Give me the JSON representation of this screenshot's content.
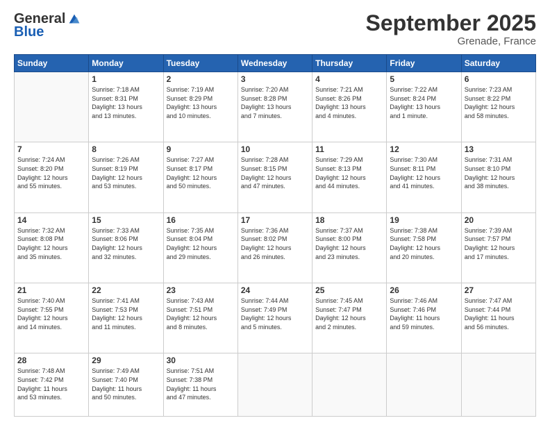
{
  "logo": {
    "general": "General",
    "blue": "Blue"
  },
  "header": {
    "month": "September 2025",
    "location": "Grenade, France"
  },
  "days_of_week": [
    "Sunday",
    "Monday",
    "Tuesday",
    "Wednesday",
    "Thursday",
    "Friday",
    "Saturday"
  ],
  "weeks": [
    [
      {
        "day": "",
        "info": ""
      },
      {
        "day": "1",
        "info": "Sunrise: 7:18 AM\nSunset: 8:31 PM\nDaylight: 13 hours\nand 13 minutes."
      },
      {
        "day": "2",
        "info": "Sunrise: 7:19 AM\nSunset: 8:29 PM\nDaylight: 13 hours\nand 10 minutes."
      },
      {
        "day": "3",
        "info": "Sunrise: 7:20 AM\nSunset: 8:28 PM\nDaylight: 13 hours\nand 7 minutes."
      },
      {
        "day": "4",
        "info": "Sunrise: 7:21 AM\nSunset: 8:26 PM\nDaylight: 13 hours\nand 4 minutes."
      },
      {
        "day": "5",
        "info": "Sunrise: 7:22 AM\nSunset: 8:24 PM\nDaylight: 13 hours\nand 1 minute."
      },
      {
        "day": "6",
        "info": "Sunrise: 7:23 AM\nSunset: 8:22 PM\nDaylight: 12 hours\nand 58 minutes."
      }
    ],
    [
      {
        "day": "7",
        "info": "Sunrise: 7:24 AM\nSunset: 8:20 PM\nDaylight: 12 hours\nand 55 minutes."
      },
      {
        "day": "8",
        "info": "Sunrise: 7:26 AM\nSunset: 8:19 PM\nDaylight: 12 hours\nand 53 minutes."
      },
      {
        "day": "9",
        "info": "Sunrise: 7:27 AM\nSunset: 8:17 PM\nDaylight: 12 hours\nand 50 minutes."
      },
      {
        "day": "10",
        "info": "Sunrise: 7:28 AM\nSunset: 8:15 PM\nDaylight: 12 hours\nand 47 minutes."
      },
      {
        "day": "11",
        "info": "Sunrise: 7:29 AM\nSunset: 8:13 PM\nDaylight: 12 hours\nand 44 minutes."
      },
      {
        "day": "12",
        "info": "Sunrise: 7:30 AM\nSunset: 8:11 PM\nDaylight: 12 hours\nand 41 minutes."
      },
      {
        "day": "13",
        "info": "Sunrise: 7:31 AM\nSunset: 8:10 PM\nDaylight: 12 hours\nand 38 minutes."
      }
    ],
    [
      {
        "day": "14",
        "info": "Sunrise: 7:32 AM\nSunset: 8:08 PM\nDaylight: 12 hours\nand 35 minutes."
      },
      {
        "day": "15",
        "info": "Sunrise: 7:33 AM\nSunset: 8:06 PM\nDaylight: 12 hours\nand 32 minutes."
      },
      {
        "day": "16",
        "info": "Sunrise: 7:35 AM\nSunset: 8:04 PM\nDaylight: 12 hours\nand 29 minutes."
      },
      {
        "day": "17",
        "info": "Sunrise: 7:36 AM\nSunset: 8:02 PM\nDaylight: 12 hours\nand 26 minutes."
      },
      {
        "day": "18",
        "info": "Sunrise: 7:37 AM\nSunset: 8:00 PM\nDaylight: 12 hours\nand 23 minutes."
      },
      {
        "day": "19",
        "info": "Sunrise: 7:38 AM\nSunset: 7:58 PM\nDaylight: 12 hours\nand 20 minutes."
      },
      {
        "day": "20",
        "info": "Sunrise: 7:39 AM\nSunset: 7:57 PM\nDaylight: 12 hours\nand 17 minutes."
      }
    ],
    [
      {
        "day": "21",
        "info": "Sunrise: 7:40 AM\nSunset: 7:55 PM\nDaylight: 12 hours\nand 14 minutes."
      },
      {
        "day": "22",
        "info": "Sunrise: 7:41 AM\nSunset: 7:53 PM\nDaylight: 12 hours\nand 11 minutes."
      },
      {
        "day": "23",
        "info": "Sunrise: 7:43 AM\nSunset: 7:51 PM\nDaylight: 12 hours\nand 8 minutes."
      },
      {
        "day": "24",
        "info": "Sunrise: 7:44 AM\nSunset: 7:49 PM\nDaylight: 12 hours\nand 5 minutes."
      },
      {
        "day": "25",
        "info": "Sunrise: 7:45 AM\nSunset: 7:47 PM\nDaylight: 12 hours\nand 2 minutes."
      },
      {
        "day": "26",
        "info": "Sunrise: 7:46 AM\nSunset: 7:46 PM\nDaylight: 11 hours\nand 59 minutes."
      },
      {
        "day": "27",
        "info": "Sunrise: 7:47 AM\nSunset: 7:44 PM\nDaylight: 11 hours\nand 56 minutes."
      }
    ],
    [
      {
        "day": "28",
        "info": "Sunrise: 7:48 AM\nSunset: 7:42 PM\nDaylight: 11 hours\nand 53 minutes."
      },
      {
        "day": "29",
        "info": "Sunrise: 7:49 AM\nSunset: 7:40 PM\nDaylight: 11 hours\nand 50 minutes."
      },
      {
        "day": "30",
        "info": "Sunrise: 7:51 AM\nSunset: 7:38 PM\nDaylight: 11 hours\nand 47 minutes."
      },
      {
        "day": "",
        "info": ""
      },
      {
        "day": "",
        "info": ""
      },
      {
        "day": "",
        "info": ""
      },
      {
        "day": "",
        "info": ""
      }
    ]
  ]
}
